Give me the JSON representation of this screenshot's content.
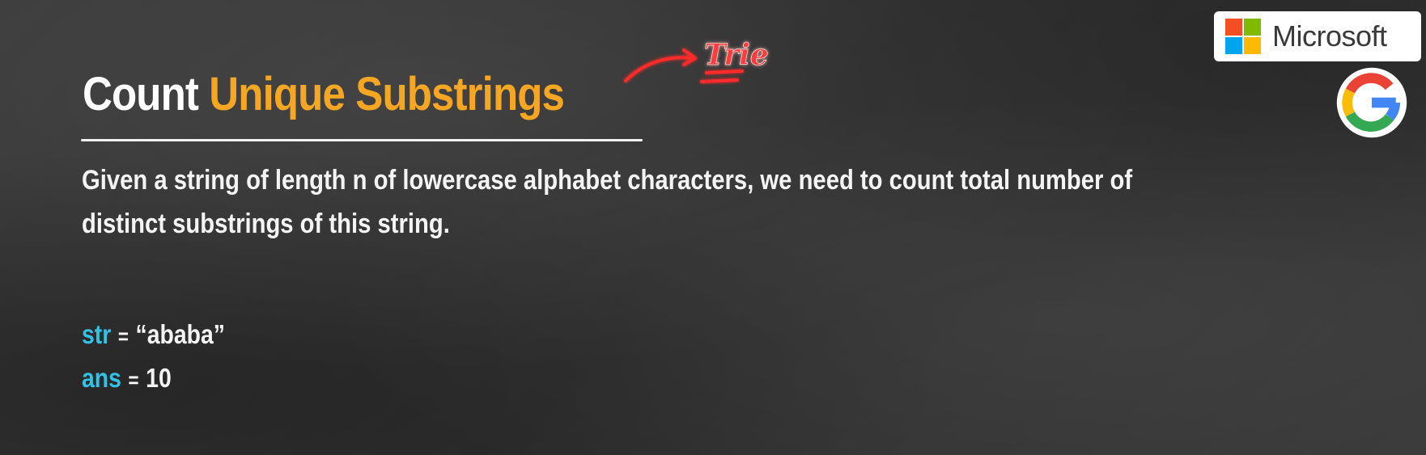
{
  "title": {
    "word1": "Count",
    "word2": "Unique Substrings"
  },
  "description": "Given a string of length n of lowercase alphabet characters, we need to count total number of distinct substrings of this string.",
  "examples": [
    {
      "key": "str",
      "sep": "=",
      "value": "“ababa”"
    },
    {
      "key": "ans",
      "sep": "=",
      "value": "10"
    }
  ],
  "annotation": {
    "text": "Trie",
    "color": "#ff2a2a",
    "icon": "arrow-icon"
  },
  "logos": {
    "microsoft": {
      "label": "Microsoft",
      "colors": [
        "#f25022",
        "#7fba00",
        "#00a4ef",
        "#ffb900"
      ]
    },
    "google": {
      "icon": "google-g-icon",
      "colors": [
        "#ea4335",
        "#fbbc05",
        "#34a853",
        "#4285f4"
      ]
    }
  },
  "colors": {
    "accent": "#f5a623",
    "keyword": "#33c2e6",
    "background": "#363636"
  }
}
